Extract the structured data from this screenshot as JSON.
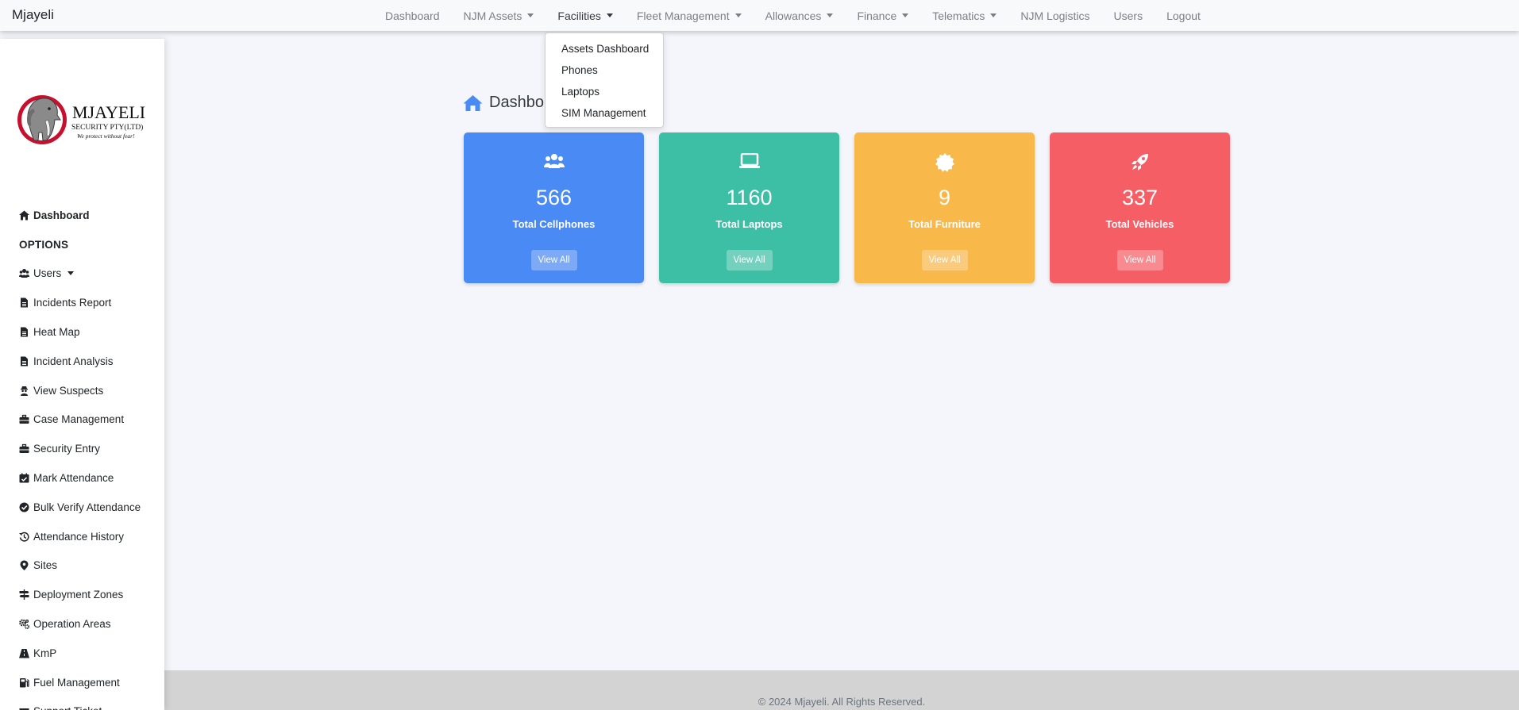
{
  "brand": "Mjayeli",
  "nav": [
    {
      "label": "Dashboard",
      "dropdown": false
    },
    {
      "label": "NJM Assets",
      "dropdown": true
    },
    {
      "label": "Facilities",
      "dropdown": true,
      "active": true
    },
    {
      "label": "Fleet Management",
      "dropdown": true
    },
    {
      "label": "Allowances",
      "dropdown": true
    },
    {
      "label": "Finance",
      "dropdown": true
    },
    {
      "label": "Telematics",
      "dropdown": true
    },
    {
      "label": "NJM Logistics",
      "dropdown": false
    },
    {
      "label": "Users",
      "dropdown": false
    },
    {
      "label": "Logout",
      "dropdown": false
    }
  ],
  "facilities_menu": [
    "Assets Dashboard",
    "Phones",
    "Laptops",
    "SIM Management"
  ],
  "logo": {
    "name": "MJAYELI",
    "line2": "SECURITY PTY(LTD)",
    "tagline": "We protect without fear!"
  },
  "sidebar": [
    {
      "label": "Dashboard",
      "icon": "home-icon",
      "style": "bold"
    },
    {
      "label": "OPTIONS",
      "icon": "",
      "style": "heading"
    },
    {
      "label": "Users",
      "icon": "users-icon",
      "style": "normal",
      "dropdown": true
    },
    {
      "label": "Incidents Report",
      "icon": "file-icon",
      "style": "normal"
    },
    {
      "label": "Heat Map",
      "icon": "file-icon",
      "style": "normal"
    },
    {
      "label": "Incident Analysis",
      "icon": "file-icon",
      "style": "normal"
    },
    {
      "label": "View Suspects",
      "icon": "user-secret-icon",
      "style": "normal"
    },
    {
      "label": "Case Management",
      "icon": "briefcase-icon",
      "style": "normal"
    },
    {
      "label": "Security Entry",
      "icon": "briefcase-icon",
      "style": "normal"
    },
    {
      "label": "Mark Attendance",
      "icon": "calendar-check-icon",
      "style": "normal"
    },
    {
      "label": "Bulk Verify Attendance",
      "icon": "check-circle-icon",
      "style": "normal"
    },
    {
      "label": "Attendance History",
      "icon": "history-icon",
      "style": "normal"
    },
    {
      "label": "Sites",
      "icon": "map-marker-icon",
      "style": "normal"
    },
    {
      "label": "Deployment Zones",
      "icon": "signs-icon",
      "style": "normal"
    },
    {
      "label": "Operation Areas",
      "icon": "cogs-icon",
      "style": "normal"
    },
    {
      "label": "KmP",
      "icon": "road-icon",
      "style": "normal"
    },
    {
      "label": "Fuel Management",
      "icon": "gas-pump-icon",
      "style": "normal"
    },
    {
      "label": "Support Ticket",
      "icon": "ticket-icon",
      "style": "normal"
    }
  ],
  "page_title": "Dashbo",
  "cards": [
    {
      "value": "566",
      "label": "Total Cellphones",
      "button": "View All",
      "color": "#4a8af4",
      "icon": "users-icon"
    },
    {
      "value": "1160",
      "label": "Total Laptops",
      "button": "View All",
      "color": "#3dbfa6",
      "icon": "laptop-icon"
    },
    {
      "value": "9",
      "label": "Total Furniture",
      "button": "View All",
      "color": "#f9b84a",
      "icon": "certificate-icon"
    },
    {
      "value": "337",
      "label": "Total Vehicles",
      "button": "View All",
      "color": "#f65e66",
      "icon": "rocket-icon"
    }
  ],
  "footer": "© 2024 Mjayeli. All Rights Reserved."
}
